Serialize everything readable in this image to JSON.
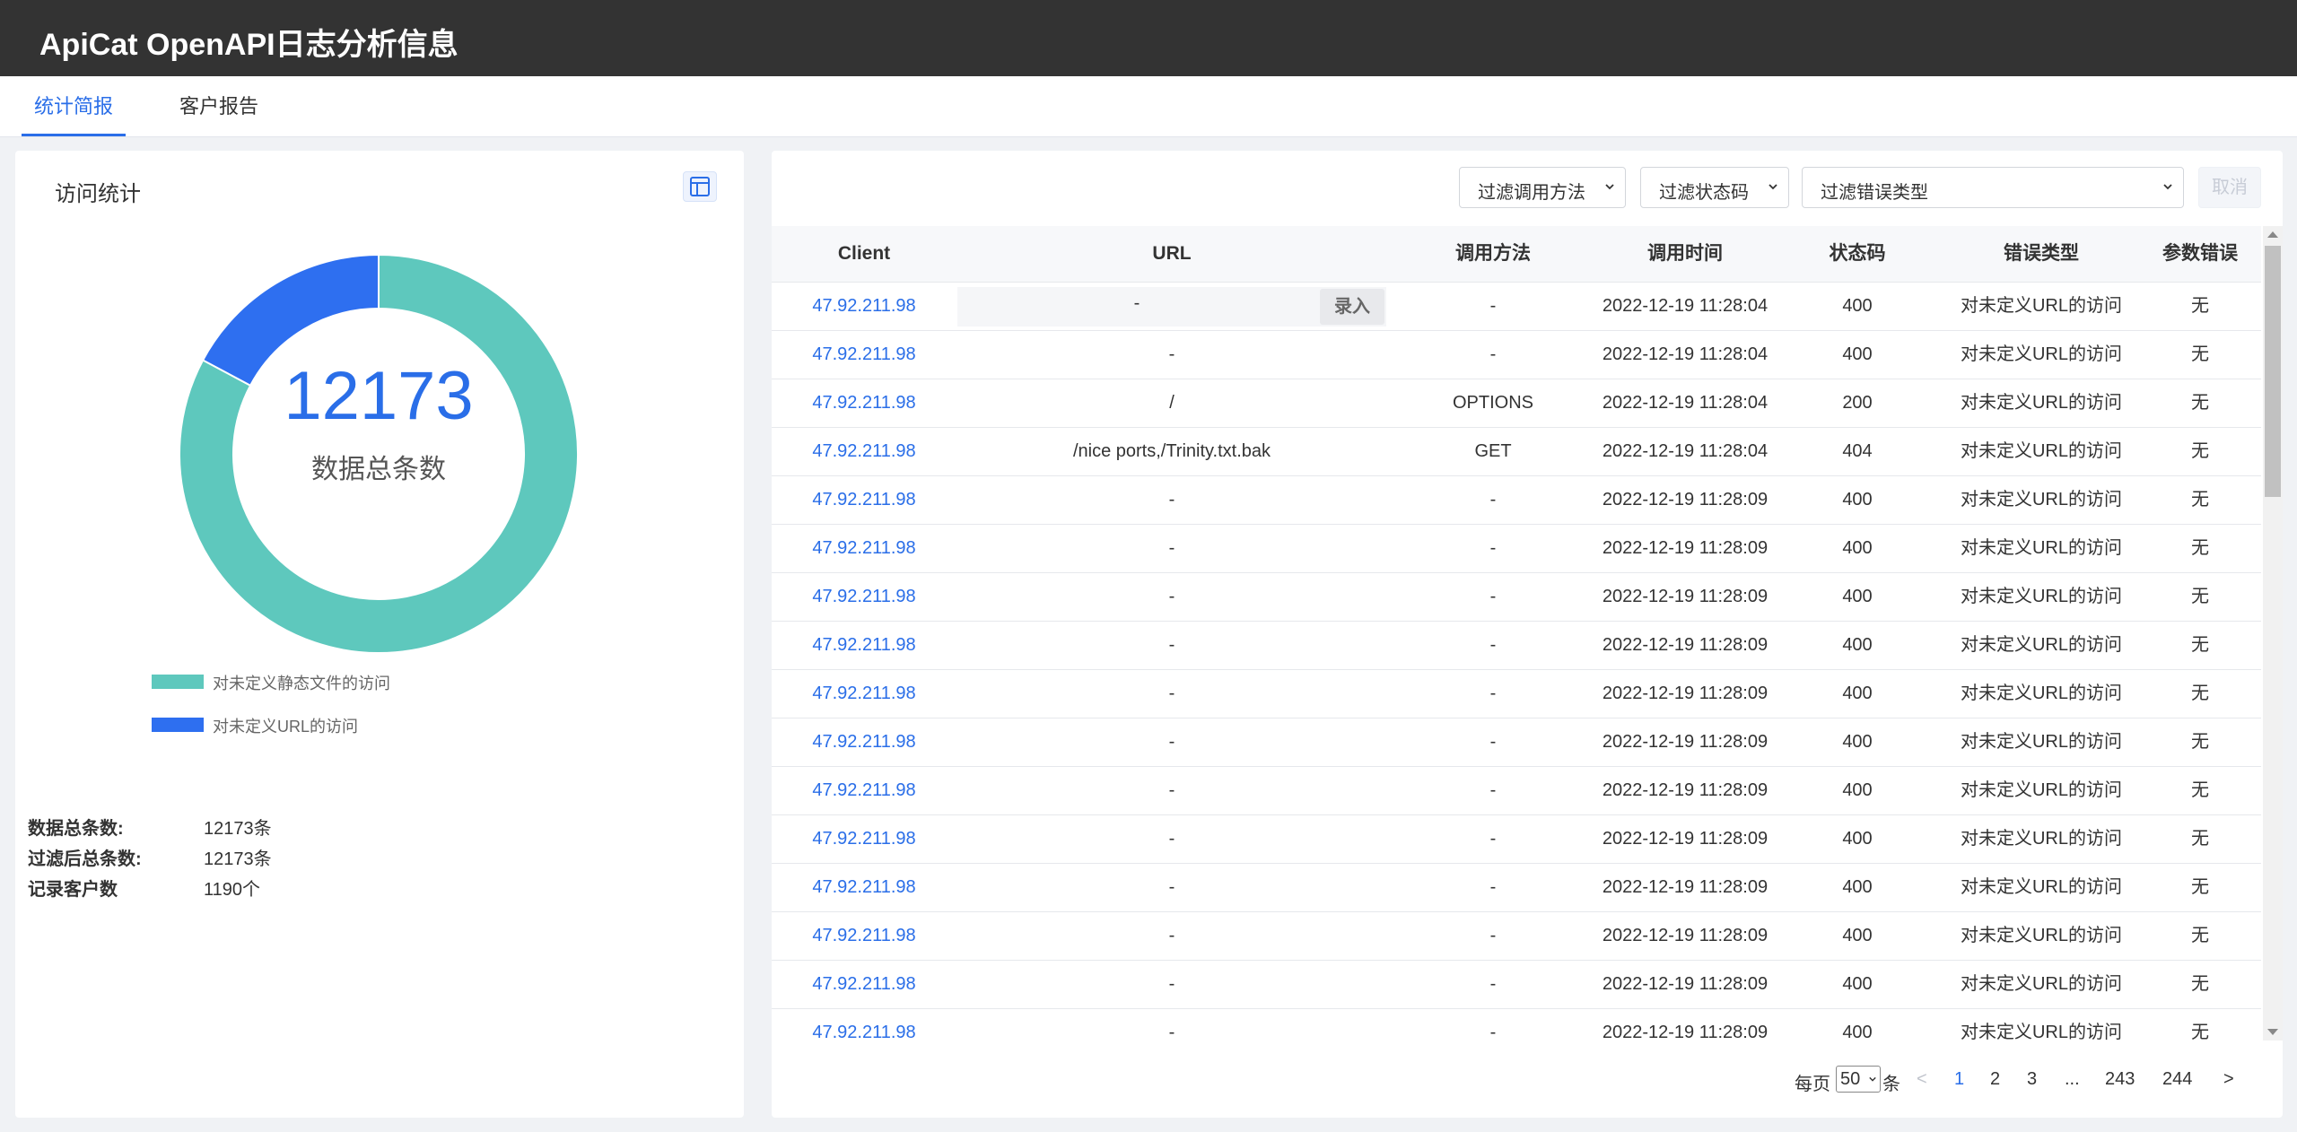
{
  "app": {
    "title": "ApiCat OpenAPI日志分析信息"
  },
  "tabs": [
    {
      "label": "统计简报",
      "active": true
    },
    {
      "label": "客户报告",
      "active": false
    }
  ],
  "left": {
    "title": "访问统计",
    "toggle_icon": "table-icon",
    "donut": {
      "total_value": "12173",
      "center_label": "数据总条数",
      "slices": [
        {
          "label": "对未定义静态文件的访问",
          "color": "#5ec8bd",
          "fraction": 0.828
        },
        {
          "label": "对未定义URL的访问",
          "color": "#2e6ff0",
          "fraction": 0.172
        }
      ]
    },
    "stats": [
      {
        "key": "数据总条数:",
        "value": "12173条"
      },
      {
        "key": "过滤后总条数:",
        "value": "12173条"
      },
      {
        "key": "记录客户数",
        "value": "1190个"
      }
    ]
  },
  "filters": {
    "method": "过滤调用方法",
    "status": "过滤状态码",
    "error_type": "过滤错误类型",
    "cancel": "取消"
  },
  "table": {
    "columns": [
      "Client",
      "URL",
      "调用方法",
      "调用时间",
      "状态码",
      "错误类型",
      "参数错误"
    ],
    "editor_button": "录入",
    "rows": [
      {
        "client": "47.92.211.98",
        "url": "-",
        "method": "-",
        "time": "2022-12-19 11:28:04",
        "status": "400",
        "error": "对未定义URL的访问",
        "param": "无"
      },
      {
        "client": "47.92.211.98",
        "url": "-",
        "method": "-",
        "time": "2022-12-19 11:28:04",
        "status": "400",
        "error": "对未定义URL的访问",
        "param": "无"
      },
      {
        "client": "47.92.211.98",
        "url": "/",
        "method": "OPTIONS",
        "time": "2022-12-19 11:28:04",
        "status": "200",
        "error": "对未定义URL的访问",
        "param": "无"
      },
      {
        "client": "47.92.211.98",
        "url": "/nice ports,/Trinity.txt.bak",
        "method": "GET",
        "time": "2022-12-19 11:28:04",
        "status": "404",
        "error": "对未定义URL的访问",
        "param": "无"
      },
      {
        "client": "47.92.211.98",
        "url": "-",
        "method": "-",
        "time": "2022-12-19 11:28:09",
        "status": "400",
        "error": "对未定义URL的访问",
        "param": "无"
      },
      {
        "client": "47.92.211.98",
        "url": "-",
        "method": "-",
        "time": "2022-12-19 11:28:09",
        "status": "400",
        "error": "对未定义URL的访问",
        "param": "无"
      },
      {
        "client": "47.92.211.98",
        "url": "-",
        "method": "-",
        "time": "2022-12-19 11:28:09",
        "status": "400",
        "error": "对未定义URL的访问",
        "param": "无"
      },
      {
        "client": "47.92.211.98",
        "url": "-",
        "method": "-",
        "time": "2022-12-19 11:28:09",
        "status": "400",
        "error": "对未定义URL的访问",
        "param": "无"
      },
      {
        "client": "47.92.211.98",
        "url": "-",
        "method": "-",
        "time": "2022-12-19 11:28:09",
        "status": "400",
        "error": "对未定义URL的访问",
        "param": "无"
      },
      {
        "client": "47.92.211.98",
        "url": "-",
        "method": "-",
        "time": "2022-12-19 11:28:09",
        "status": "400",
        "error": "对未定义URL的访问",
        "param": "无"
      },
      {
        "client": "47.92.211.98",
        "url": "-",
        "method": "-",
        "time": "2022-12-19 11:28:09",
        "status": "400",
        "error": "对未定义URL的访问",
        "param": "无"
      },
      {
        "client": "47.92.211.98",
        "url": "-",
        "method": "-",
        "time": "2022-12-19 11:28:09",
        "status": "400",
        "error": "对未定义URL的访问",
        "param": "无"
      },
      {
        "client": "47.92.211.98",
        "url": "-",
        "method": "-",
        "time": "2022-12-19 11:28:09",
        "status": "400",
        "error": "对未定义URL的访问",
        "param": "无"
      },
      {
        "client": "47.92.211.98",
        "url": "-",
        "method": "-",
        "time": "2022-12-19 11:28:09",
        "status": "400",
        "error": "对未定义URL的访问",
        "param": "无"
      },
      {
        "client": "47.92.211.98",
        "url": "-",
        "method": "-",
        "time": "2022-12-19 11:28:09",
        "status": "400",
        "error": "对未定义URL的访问",
        "param": "无"
      },
      {
        "client": "47.92.211.98",
        "url": "-",
        "method": "-",
        "time": "2022-12-19 11:28:09",
        "status": "400",
        "error": "对未定义URL的访问",
        "param": "无"
      }
    ]
  },
  "pagination": {
    "per_page_prefix": "每页",
    "page_size": "50",
    "per_page_suffix": "条",
    "prev": "<",
    "pages": [
      "1",
      "2",
      "3",
      "...",
      "243",
      "244"
    ],
    "current": "1",
    "next": ">"
  },
  "colors": {
    "accent": "#2a6ee8",
    "header_bg": "#333333"
  }
}
